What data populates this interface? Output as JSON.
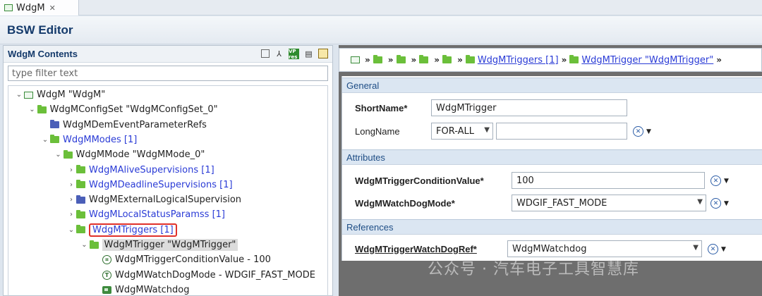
{
  "tab": {
    "label": "WdgM",
    "close": "✕"
  },
  "editor": {
    "title": "BSW Editor"
  },
  "left": {
    "title": "WdgM Contents",
    "filter_placeholder": "type filter text",
    "tool_vp": "VP res",
    "tree": [
      {
        "label": "WdgM \"WdgM\"",
        "icon": "window-icon",
        "chev": "⌄",
        "depth": 0
      },
      {
        "label": "WdgMConfigSet \"WdgMConfigSet_0\"",
        "icon": "folder-green",
        "chev": "⌄",
        "depth": 1
      },
      {
        "label": "WdgMDemEventParameterRefs",
        "icon": "folder-blue",
        "chev": "",
        "depth": 2
      },
      {
        "label": "WdgMModes [1]",
        "icon": "folder-green",
        "chev": "⌄",
        "depth": 2,
        "link": true
      },
      {
        "label": "WdgMMode \"WdgMMode_0\"",
        "icon": "folder-green",
        "chev": "⌄",
        "depth": 3
      },
      {
        "label": "WdgMAliveSupervisions [1]",
        "icon": "folder-green",
        "chev": "›",
        "depth": 4,
        "link": true
      },
      {
        "label": "WdgMDeadlineSupervisions [1]",
        "icon": "folder-green",
        "chev": "›",
        "depth": 4,
        "link": true
      },
      {
        "label": "WdgMExternalLogicalSupervision",
        "icon": "folder-blue",
        "chev": "›",
        "depth": 4
      },
      {
        "label": "WdgMLocalStatusParamss [1]",
        "icon": "folder-green",
        "chev": "›",
        "depth": 4,
        "link": true
      },
      {
        "label": "WdgMTriggers [1]",
        "icon": "folder-green",
        "chev": "⌄",
        "depth": 4,
        "link": true,
        "highlight": true
      },
      {
        "label": "WdgMTrigger \"WdgMTrigger\"",
        "icon": "folder-green",
        "chev": "⌄",
        "depth": 5,
        "selected": true
      },
      {
        "label": "WdgMTriggerConditionValue - 100",
        "icon": "param-int",
        "chev": "",
        "depth": 6
      },
      {
        "label": "WdgMWatchDogMode - WDGIF_FAST_MODE",
        "icon": "param-enum",
        "chev": "",
        "depth": 6
      },
      {
        "label": "WdgMWatchdog",
        "icon": "reference",
        "chev": "",
        "depth": 6
      }
    ]
  },
  "breadcrumb": {
    "sep": "»",
    "link1": "WdgMTriggers [1]",
    "link2": "WdgMTrigger \"WdgMTrigger\"",
    "end": "»"
  },
  "form": {
    "general": {
      "title": "General",
      "shortname_label": "ShortName*",
      "shortname_value": "WdgMTrigger",
      "longname_label": "LongName",
      "lang_value": "FOR-ALL",
      "longname_value": ""
    },
    "attributes": {
      "title": "Attributes",
      "cond_label": "WdgMTriggerConditionValue*",
      "cond_value": "100",
      "mode_label": "WdgMWatchDogMode*",
      "mode_value": "WDGIF_FAST_MODE"
    },
    "references": {
      "title": "References",
      "ref_label": "WdgMTriggerWatchDogRef*",
      "ref_value": "WdgMWatchdog"
    }
  },
  "watermark": "公众号 · 汽车电子工具智慧库",
  "colors": {
    "link": "#2a3bd6",
    "folder_green": "#6bbf3a",
    "folder_blue": "#4b5fb8",
    "highlight": "#e0302a",
    "section_bg": "#dbe6f2"
  }
}
